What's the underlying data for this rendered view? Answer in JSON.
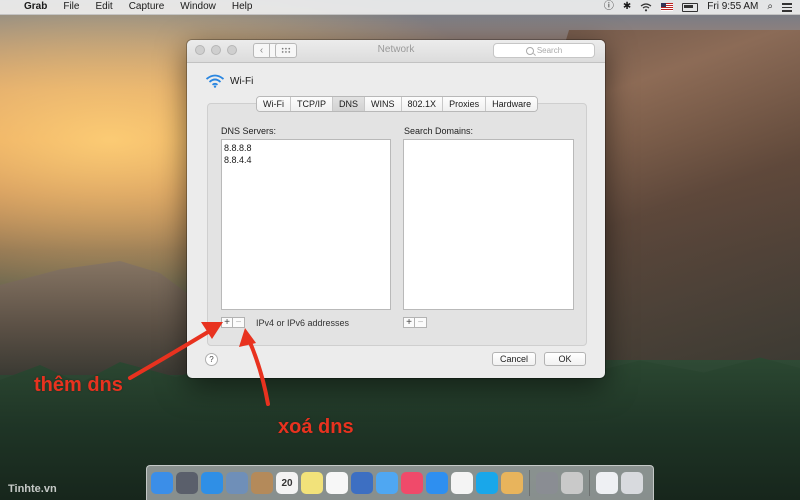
{
  "menubar": {
    "apple_glyph": "",
    "app_name": "Grab",
    "menus": [
      "File",
      "Edit",
      "Capture",
      "Window",
      "Help"
    ],
    "clock": "Fri 9:55 AM"
  },
  "window": {
    "title": "Network",
    "search_placeholder": "Search",
    "interface_name": "Wi-Fi",
    "tabs": [
      "Wi-Fi",
      "TCP/IP",
      "DNS",
      "WINS",
      "802.1X",
      "Proxies",
      "Hardware"
    ],
    "active_tab": "DNS",
    "dns_servers_label": "DNS Servers:",
    "dns_servers": [
      "8.8.8.8",
      "8.8.4.4"
    ],
    "search_domains_label": "Search Domains:",
    "search_domains": [],
    "add_glyph": "+",
    "remove_glyph": "−",
    "address_hint": "IPv4 or IPv6 addresses",
    "help_glyph": "?",
    "cancel_label": "Cancel",
    "ok_label": "OK"
  },
  "annotations": {
    "add_dns": "thêm dns",
    "remove_dns": "xoá dns",
    "color": "#e8321f"
  },
  "dock": {
    "apps": [
      {
        "name": "finder-icon",
        "color": "#3b8ee8"
      },
      {
        "name": "launchpad-icon",
        "color": "#5a5f6b"
      },
      {
        "name": "safari-icon",
        "color": "#2f8fe6"
      },
      {
        "name": "preview-icon",
        "color": "#6f8fb8"
      },
      {
        "name": "contacts-icon",
        "color": "#b48a5a"
      },
      {
        "name": "calendar-icon",
        "color": "#f3f3f3"
      },
      {
        "name": "notes-icon",
        "color": "#f2e27a"
      },
      {
        "name": "reminders-icon",
        "color": "#f7f7f7"
      },
      {
        "name": "keynote-icon",
        "color": "#3d6fc2"
      },
      {
        "name": "messages-icon",
        "color": "#4fa7f2"
      },
      {
        "name": "itunes-icon",
        "color": "#f04a6a"
      },
      {
        "name": "app-store-icon",
        "color": "#2e8ff0"
      },
      {
        "name": "photos-icon",
        "color": "#f4f4f4"
      },
      {
        "name": "skype-icon",
        "color": "#19a7ea"
      },
      {
        "name": "grab-icon",
        "color": "#e8b45c"
      },
      {
        "name": "system-preferences-icon",
        "color": "#8a8d93"
      },
      {
        "name": "terminal-icon",
        "color": "#c9c9c9"
      }
    ],
    "calendar_day": "20",
    "watermark": "Tinhte.vn"
  }
}
